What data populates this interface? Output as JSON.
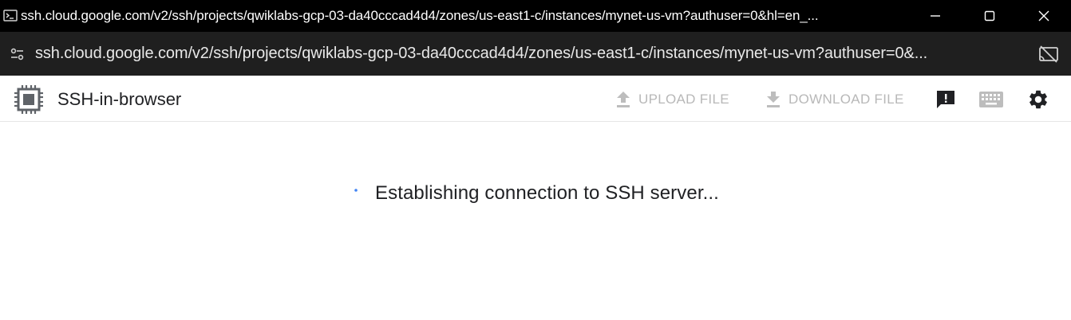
{
  "window": {
    "title": "ssh.cloud.google.com/v2/ssh/projects/qwiklabs-gcp-03-da40cccad4d4/zones/us-east1-c/instances/mynet-us-vm?authuser=0&hl=en_...",
    "controls": [
      "minimize-icon",
      "maximize-icon",
      "close-icon"
    ]
  },
  "address_bar": {
    "url": "ssh.cloud.google.com/v2/ssh/projects/qwiklabs-gcp-03-da40cccad4d4/zones/us-east1-c/instances/mynet-us-vm?authuser=0&...",
    "icons": [
      "site-info-icon",
      "cast-off-icon"
    ]
  },
  "toolbar": {
    "app_title": "SSH-in-browser",
    "upload_label": "UPLOAD FILE",
    "download_label": "DOWNLOAD FILE",
    "icons": [
      "chip-icon",
      "upload-icon",
      "download-icon",
      "feedback-icon",
      "keyboard-icon",
      "gear-icon"
    ]
  },
  "main": {
    "status_text": "Establishing connection to SSH server..."
  },
  "colors": {
    "titlebar_bg": "#000000",
    "addressbar_bg": "#1f1f1f",
    "disabled_action": "#b8b8b8",
    "icon_dark": "#202124",
    "spinner": "#4285f4"
  }
}
